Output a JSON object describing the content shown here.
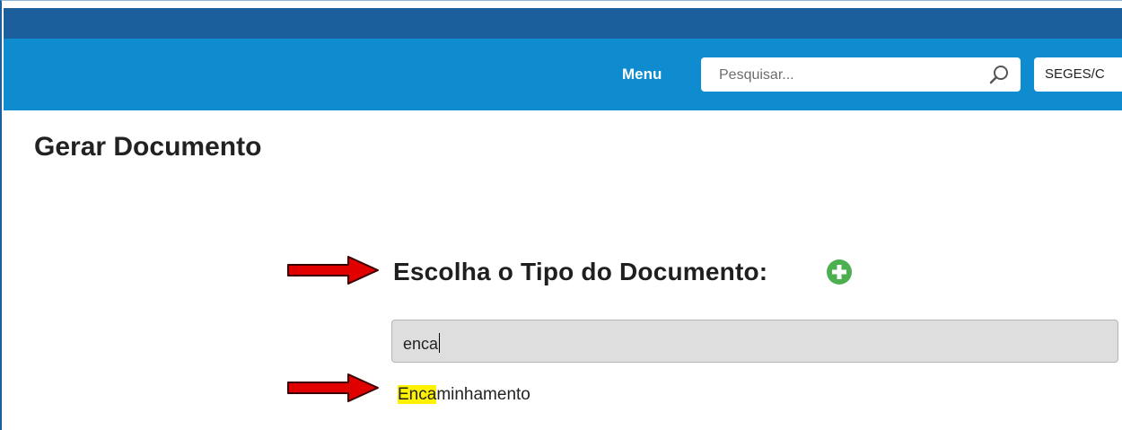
{
  "header": {
    "menu_label": "Menu",
    "search_placeholder": "Pesquisar...",
    "unit_label": "SEGES/C"
  },
  "page": {
    "title": "Gerar Documento"
  },
  "document_type": {
    "heading": "Escolha o Tipo do Documento:",
    "filter_value": "enca",
    "results": [
      {
        "highlight": "Enca",
        "rest": "minhamento"
      }
    ]
  },
  "colors": {
    "header_dark": "#1b5f9c",
    "header_light": "#0e8ccf",
    "add_icon": "#4caf50",
    "highlight": "#fff200",
    "arrow": "#e00000"
  },
  "icons": {
    "search": "magnifier-icon",
    "add": "plus-circle-icon",
    "annotation": "red-arrow-icon"
  }
}
